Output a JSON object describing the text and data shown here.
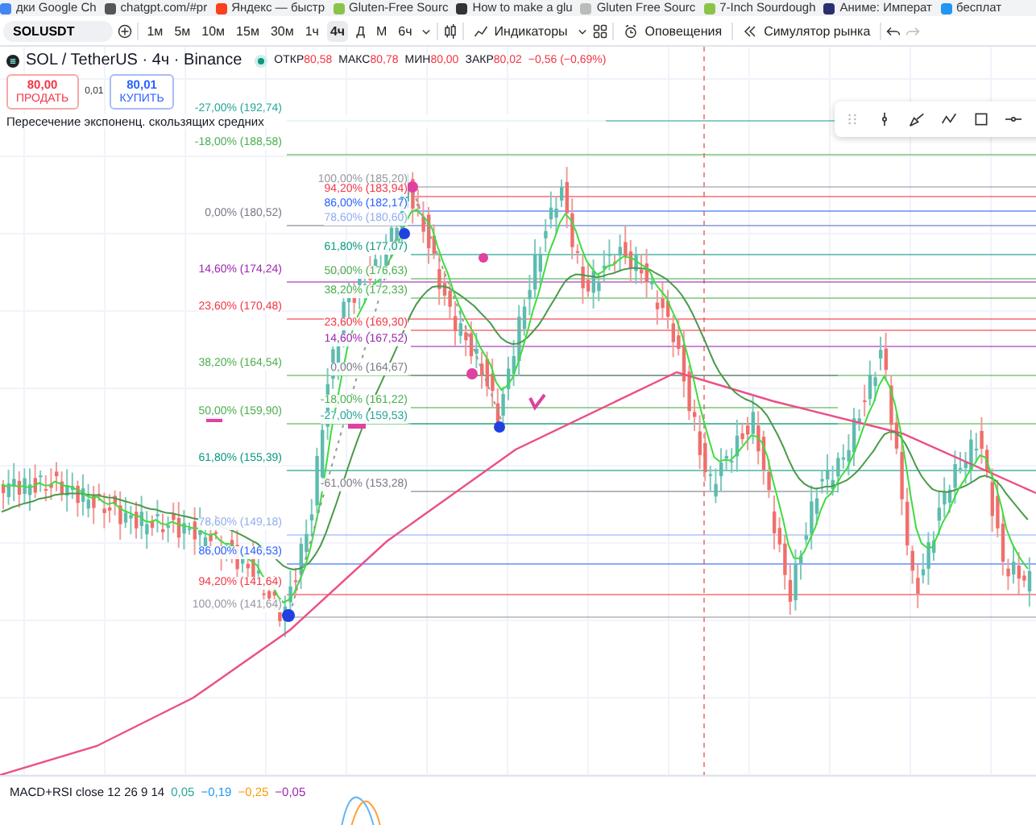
{
  "bookmarks": [
    {
      "label": "дки Google Ch",
      "color": "#4285f4"
    },
    {
      "label": "chatgpt.com/#pr",
      "color": "#555555"
    },
    {
      "label": "Яндекс — быстр",
      "color": "#fc3f1d"
    },
    {
      "label": "Gluten-Free Sourc",
      "color": "#8bc34a"
    },
    {
      "label": "How to make a glu",
      "color": "#333333"
    },
    {
      "label": "Gluten Free Sourc",
      "color": "#bbbbbb"
    },
    {
      "label": "7-Inch Sourdough",
      "color": "#8bc34a"
    },
    {
      "label": "Аниме: Императ",
      "color": "#2a2f6e"
    },
    {
      "label": "бесплат",
      "color": "#2196f3"
    }
  ],
  "toolbar": {
    "symbol": "SOLUSDT",
    "intervals": [
      {
        "label": "1м",
        "selected": false
      },
      {
        "label": "5м",
        "selected": false
      },
      {
        "label": "10м",
        "selected": false
      },
      {
        "label": "15м",
        "selected": false
      },
      {
        "label": "30м",
        "selected": false
      },
      {
        "label": "1ч",
        "selected": false
      },
      {
        "label": "4ч",
        "selected": true
      },
      {
        "label": "Д",
        "selected": false
      },
      {
        "label": "М",
        "selected": false
      },
      {
        "label": "6ч",
        "selected": false
      }
    ],
    "indicators": "Индикаторы",
    "alerts": "Оповещения",
    "replay": "Симулятор рынка"
  },
  "legend": {
    "title": "SOL / TetherUS · 4ч · Binance",
    "ohlc": [
      {
        "label": "ОТКР",
        "value": "80,58"
      },
      {
        "label": "МАКС",
        "value": "80,78"
      },
      {
        "label": "МИН",
        "value": "80,00"
      },
      {
        "label": "ЗАКР",
        "value": "80,02"
      }
    ],
    "change": "−0,56 (−0,69%)",
    "sell": {
      "price": "80,00",
      "label": "ПРОДАТЬ"
    },
    "spread": "0,01",
    "buy": {
      "price": "80,01",
      "label": "КУПИТЬ"
    },
    "indicator": "Пересечение экспоненц. скользящих средних"
  },
  "fib_left": [
    {
      "label": "-27,00% (192,74)",
      "color": "#26a69a"
    },
    {
      "label": "-18,00% (188,58)",
      "color": "#4caf50"
    },
    {
      "label": "0,00% (180,52)",
      "color": "#787b86"
    },
    {
      "label": "14,60% (174,24)",
      "color": "#9c27b0"
    },
    {
      "label": "23,60% (170,48)",
      "color": "#f23645"
    },
    {
      "label": "38,20% (164,54)",
      "color": "#4caf50"
    },
    {
      "label": "50,00% (159,90)",
      "color": "#4caf50"
    },
    {
      "label": "61,80% (155,39)",
      "color": "#089981"
    },
    {
      "label": "78,60% (149,18)",
      "color": "#90aef0"
    },
    {
      "label": "86,00% (146,53)",
      "color": "#2962ff"
    },
    {
      "label": "94,20% (141,64)",
      "color": "#f23645"
    },
    {
      "label": "100,00% (141,64)",
      "color": "#9598a1"
    }
  ],
  "fib_right": [
    {
      "label": "100,00% (185,20)",
      "color": "#9598a1"
    },
    {
      "label": "94,20% (183,94)",
      "color": "#f23645"
    },
    {
      "label": "86,00% (182,17)",
      "color": "#2962ff"
    },
    {
      "label": "78,60% (180,60)",
      "color": "#90aef0"
    },
    {
      "label": "61,80% (177,07)",
      "color": "#089981"
    },
    {
      "label": "50,00% (176,63)",
      "color": "#4caf50"
    },
    {
      "label": "38,20% (172,33)",
      "color": "#4caf50"
    },
    {
      "label": "23,60% (169,30)",
      "color": "#f23645"
    },
    {
      "label": "14,60% (167,52)",
      "color": "#9c27b0"
    },
    {
      "label": "0,00% (164,67)",
      "color": "#787b86"
    },
    {
      "label": "-18,00% (161,22)",
      "color": "#4caf50"
    },
    {
      "label": "-27,00% (159,53)",
      "color": "#26a69a"
    },
    {
      "label": "-61,00% (153,28)",
      "color": "#787b86"
    }
  ],
  "macd": {
    "title": "MACD+RSI close 12 26 9 14",
    "values": [
      {
        "value": "0,05",
        "color": "#26a69a"
      },
      {
        "value": "−0,19",
        "color": "#2196f3"
      },
      {
        "value": "−0,25",
        "color": "#ff9800"
      },
      {
        "value": "−0,05",
        "color": "#9c27b0"
      }
    ]
  }
}
